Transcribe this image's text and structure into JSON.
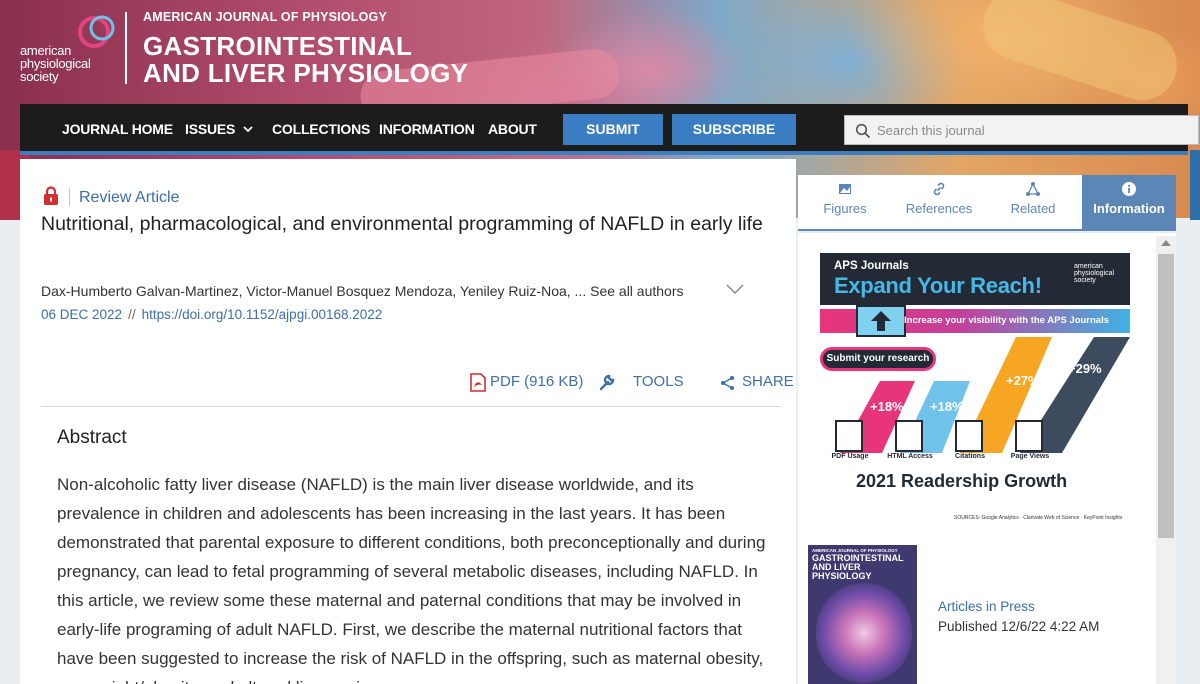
{
  "header": {
    "society_logo_text": "american\nphysiological\nsociety",
    "journal_kicker": "AMERICAN JOURNAL OF PHYSIOLOGY",
    "journal_name_line1": "GASTROINTESTINAL",
    "journal_name_line2": "AND LIVER PHYSIOLOGY"
  },
  "nav": {
    "items": [
      "JOURNAL HOME",
      "ISSUES",
      "COLLECTIONS",
      "INFORMATION",
      "ABOUT"
    ],
    "submit_label": "SUBMIT",
    "subscribe_label": "SUBSCRIBE",
    "search_placeholder": "Search this journal"
  },
  "article": {
    "type": "Review Article",
    "title": "Nutritional, pharmacological, and environmental programming of NAFLD in early life",
    "authors": "Dax-Humberto Galvan-Martinez, Victor-Manuel Bosquez Mendoza, Yeniley Ruiz-Noa, ...",
    "see_all_authors": "See all authors",
    "date": "06 DEC 2022",
    "date_separator": "//",
    "doi": "https://doi.org/10.1152/ajpgi.00168.2022",
    "tools": {
      "pdf_label": "PDF (916 KB)",
      "tools_label": "TOOLS",
      "share_label": "SHARE"
    },
    "abstract_heading": "Abstract",
    "abstract_text": "Non-alcoholic fatty liver disease (NAFLD) is the main liver disease worldwide, and its prevalence in children and adolescents has been increasing in the last years. It has been demonstrated that parental exposure to different conditions, both preconceptionally and during pregnancy, can lead to fetal programming of several metabolic diseases, including NAFLD. In this article, we review some these maternal and paternal conditions that may be involved in early-life programing of adult NAFLD. First, we describe the maternal nutritional factors that have been suggested to increase the risk of NAFLD in the offspring, such as maternal obesity, overweight/obesity, and altered liver regions"
  },
  "sidebar": {
    "tabs": [
      {
        "label": "Figures",
        "icon": "image-icon",
        "active": false
      },
      {
        "label": "References",
        "icon": "link-icon",
        "active": false
      },
      {
        "label": "Related",
        "icon": "network-icon",
        "active": false
      },
      {
        "label": "Information",
        "icon": "info-icon",
        "active": true
      }
    ],
    "ad": {
      "kicker": "APS Journals",
      "headline": "Expand Your Reach!",
      "logo_text": "american physiological society",
      "ribbon_text": "Increase your visibility with the APS Journals",
      "submit_label": "Submit your research",
      "metrics": [
        {
          "label": "PDF Usage",
          "value": "+18%"
        },
        {
          "label": "HTML Access",
          "value": "+18%"
        },
        {
          "label": "Citations",
          "value": "+27%"
        },
        {
          "label": "Page Views",
          "value": "+29%"
        }
      ],
      "growth_title": "2021 Readership Growth",
      "sources": "SOURCES: Google Analytics · Clarivate Web of Science · KeyPoint Insights"
    },
    "cover": {
      "kicker": "AMERICAN JOURNAL OF PHYSIOLOGY",
      "name": "GASTROINTESTINAL AND LIVER PHYSIOLOGY"
    },
    "articles_in_press_label": "Articles in Press",
    "published_text": "Published 12/6/22 4:22 AM"
  },
  "colors": {
    "nav_bg": "#1c1c1c",
    "accent_blue": "#3a7dc2",
    "link_blue": "#3d6fa8",
    "tab_active": "#5c86b5",
    "pdf_red": "#d32f2f"
  }
}
